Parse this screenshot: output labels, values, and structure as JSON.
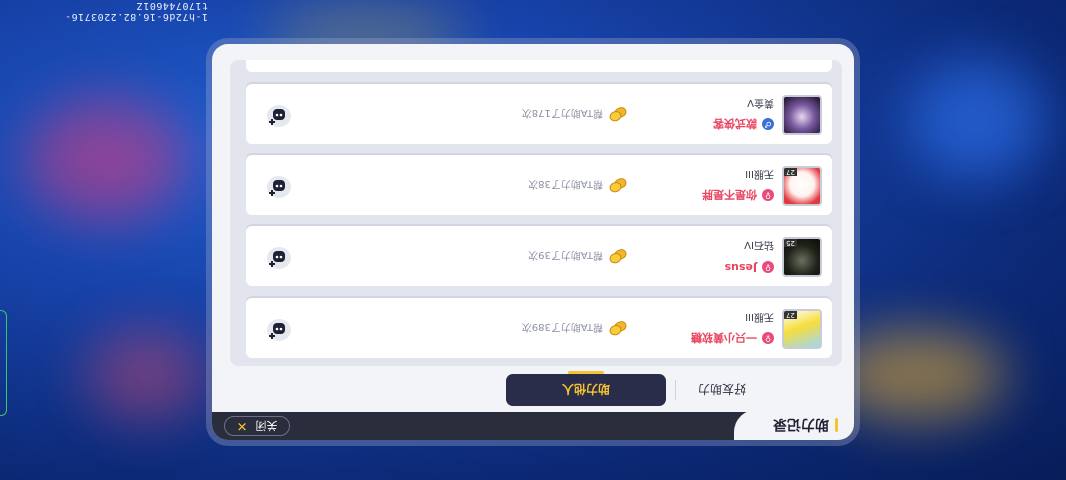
{
  "build_code": "1-h72d6-16.82.2203716-t170744601Z",
  "panel": {
    "title": "助力记录",
    "close_label": "关闭",
    "tabs": [
      {
        "label": "好友助力",
        "active": false
      },
      {
        "label": "助力他人",
        "active": true
      }
    ]
  },
  "records": [
    {
      "name": "一只小黄软糖",
      "gender": "female",
      "subtitle": "无服III",
      "helped_text": "帮TA助力了389次",
      "avatar": "yellow-duck-avatar",
      "avatar_badge": "27"
    },
    {
      "name": "Jesus",
      "gender": "female",
      "subtitle": "钻石IV",
      "helped_text": "帮TA助力了39次",
      "avatar": "dark-figure-avatar",
      "avatar_badge": "25"
    },
    {
      "name": "你是不是胖",
      "gender": "female",
      "subtitle": "无服III",
      "helped_text": "帮TA助力了38次",
      "avatar": "white-cat-avatar",
      "avatar_badge": "27"
    },
    {
      "name": "款式侠客",
      "gender": "male",
      "subtitle": "黄金V",
      "helped_text": "帮TA助力了178次",
      "avatar": "purple-girl-avatar",
      "avatar_badge": ""
    }
  ],
  "colors": {
    "accent": "#f5c431",
    "dark": "#2a2d4a",
    "female": "#e84a7a",
    "male": "#3a6fd8",
    "name_red": "#e8445f"
  }
}
